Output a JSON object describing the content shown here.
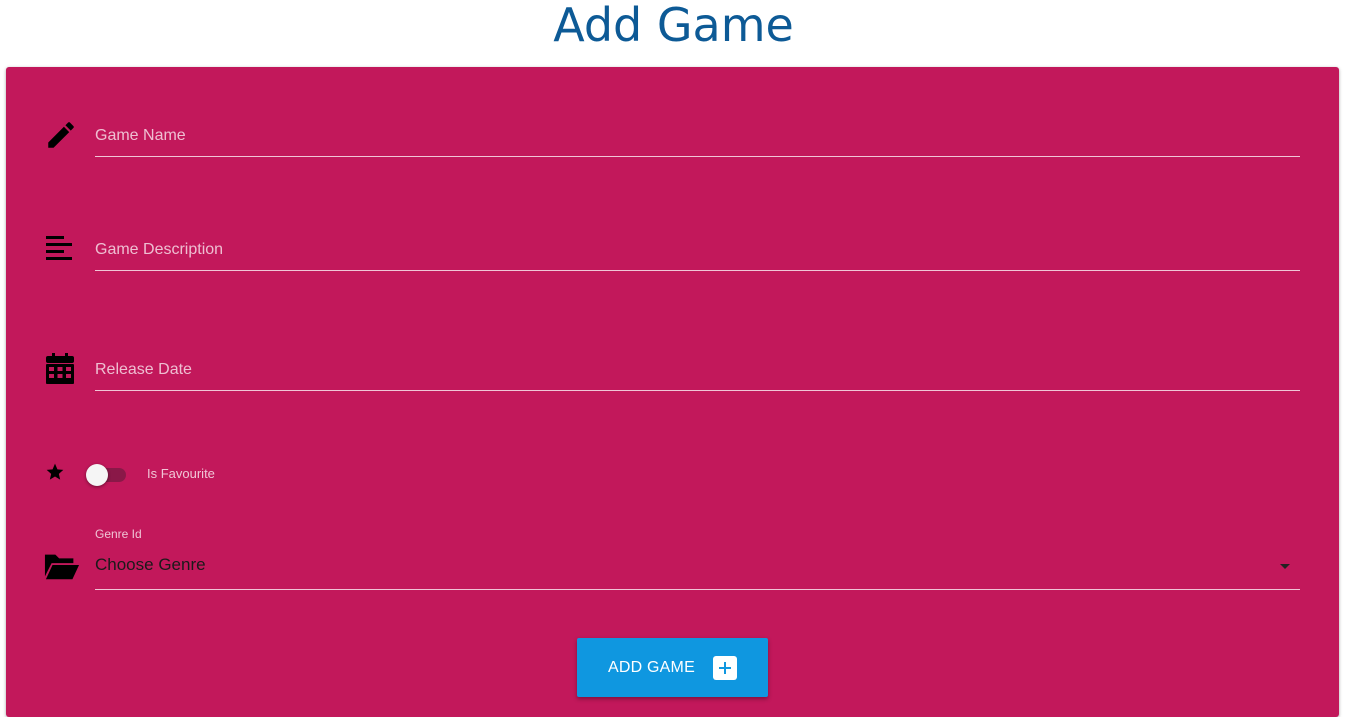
{
  "page": {
    "title": "Add Game"
  },
  "colors": {
    "title": "#0d5a96",
    "card_background": "#c2185b",
    "button_background": "#0f97e0"
  },
  "form": {
    "game_name": {
      "placeholder": "Game Name",
      "value": "",
      "icon": "pencil-icon"
    },
    "game_description": {
      "placeholder": "Game Description",
      "value": "",
      "icon": "align-left-icon"
    },
    "release_date": {
      "placeholder": "Release Date",
      "value": "",
      "icon": "calendar-icon"
    },
    "is_favourite": {
      "label": "Is Favourite",
      "checked": false,
      "icon": "star-icon"
    },
    "genre": {
      "label": "Genre Id",
      "selected": "Choose Genre",
      "icon": "folder-open-icon"
    },
    "submit": {
      "label": "ADD GAME",
      "icon": "plus-square-icon"
    }
  }
}
